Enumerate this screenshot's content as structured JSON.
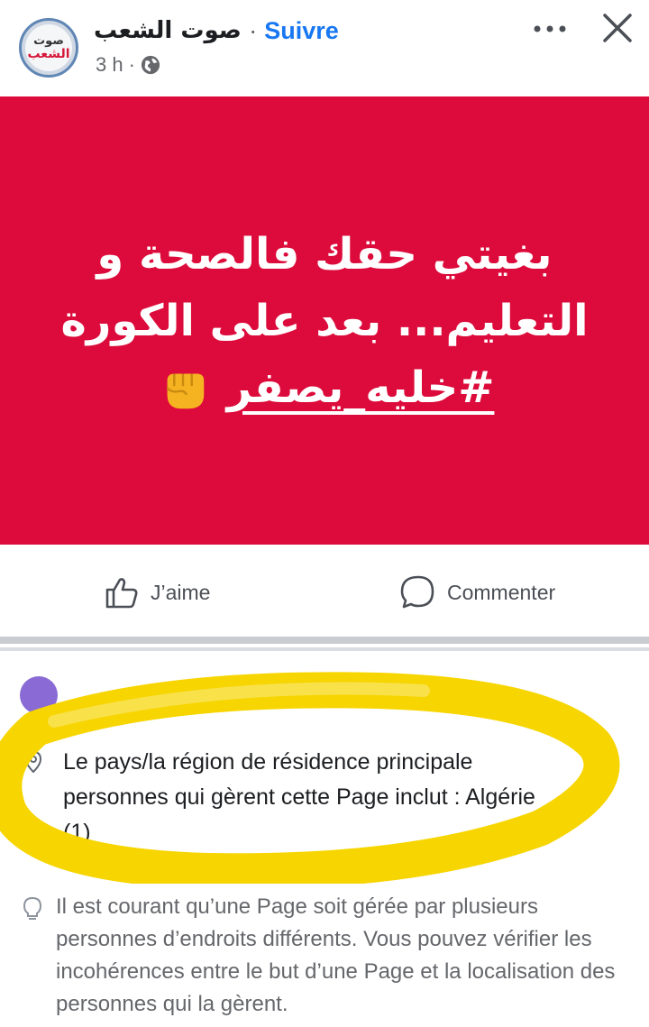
{
  "header": {
    "page_name": "صوت الشعب",
    "separator": "·",
    "follow_label": "Suivre",
    "time": "3 h",
    "time_separator": "·",
    "avatar_text_line1": "صوت",
    "avatar_text_line2": "الشعب",
    "icons": [
      "globe-icon",
      "more-icon",
      "close-icon"
    ]
  },
  "post": {
    "background_color": "#dc0b3b",
    "line1": "بغيتي حقك فالصحة و",
    "line2": "التعليم... بعد على الكورة",
    "hashtag": "#خليه_يصفر",
    "emoji": "raised-fist"
  },
  "actions": {
    "like_label": "J’aime",
    "comment_label": "Commenter"
  },
  "transparency": {
    "residence_text": "Le pays/la région de résidence principale personnes qui gèrent cette Page inclut : Algérie (1)",
    "info_text": "Il est courant qu’une Page soit gérée par plusieurs personnes d’endroits différents. Vous pouvez vérifier les incohérences entre le but d’une Page et la localisation des personnes qui la gèrent."
  },
  "colors": {
    "follow_blue": "#1877f2",
    "highlight_yellow": "#f7d500",
    "avatar_purple": "#8a6bd6"
  }
}
